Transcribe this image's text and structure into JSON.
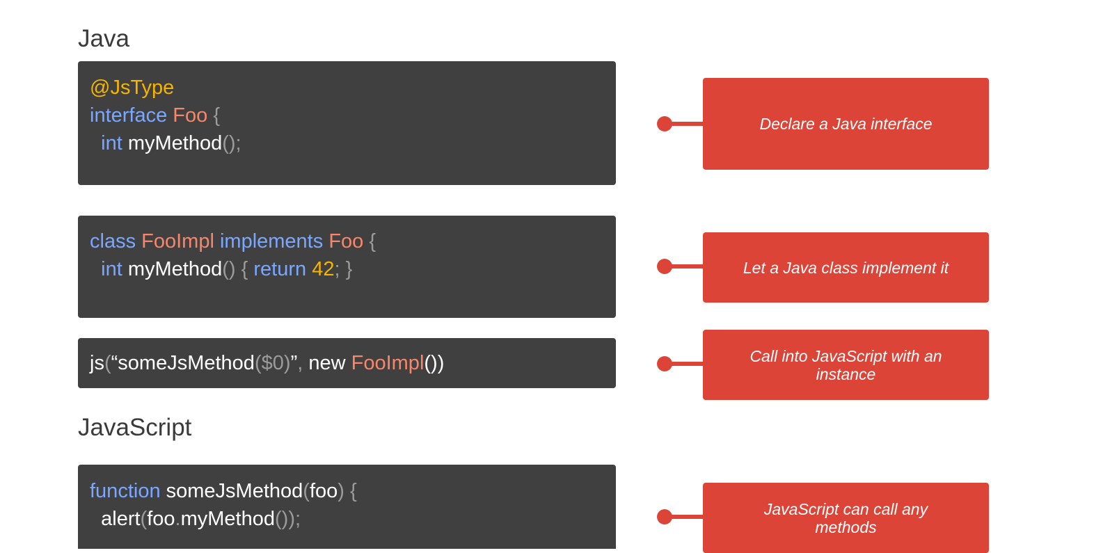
{
  "headings": {
    "java": "Java",
    "javascript": "JavaScript"
  },
  "code": {
    "block1": {
      "line1": {
        "annotation": "@JsType"
      },
      "line2": {
        "kw": "interface",
        "type": "Foo",
        "brace": "{"
      },
      "line3": {
        "indent": "  ",
        "kw": "int",
        "name": "myMethod",
        "punc": "();"
      }
    },
    "block2": {
      "line1": {
        "kw1": "class",
        "type1": "FooImpl",
        "kw2": "implements",
        "type2": "Foo",
        "brace": "{"
      },
      "line2": {
        "indent": "  ",
        "kw": "int",
        "name": "myMethod",
        "parens": "()",
        "open": "{",
        "kw_return": "return",
        "num": "42",
        "semi": ";",
        "close": "}"
      }
    },
    "block3": {
      "line1": {
        "fn": "js",
        "open": "(",
        "q1": "“",
        "str": "someJsMethod",
        "arg_open": "(",
        "arg": "$0",
        "arg_close": ")",
        "q2": "”",
        "comma": ",",
        "kw_new": "new",
        "type": "FooImpl",
        "call": "()",
        "close": ")"
      }
    },
    "block4": {
      "line1": {
        "kw": "function",
        "name": "someJsMethod",
        "open": "(",
        "param": "foo",
        "close": ")",
        "brace": "{"
      },
      "line2": {
        "indent": "  ",
        "fn": "alert",
        "open": "(",
        "obj": "foo",
        "dot": ".",
        "method": "myMethod",
        "call": "()",
        "close": ")",
        "semi": ";"
      }
    }
  },
  "callouts": [
    {
      "text": "Declare a Java interface"
    },
    {
      "text": "Let a Java class implement it"
    },
    {
      "text": "Call into JavaScript with an instance"
    },
    {
      "text": "JavaScript can call any methods"
    }
  ],
  "colors": {
    "code_background": "#404040",
    "callout_background": "#dd4438",
    "annotation": "#f4b400",
    "keyword": "#7aa7ff",
    "type": "#f7876b",
    "punctuation": "#9b9b9b",
    "identifier": "#ffffff",
    "number": "#f4b400"
  }
}
